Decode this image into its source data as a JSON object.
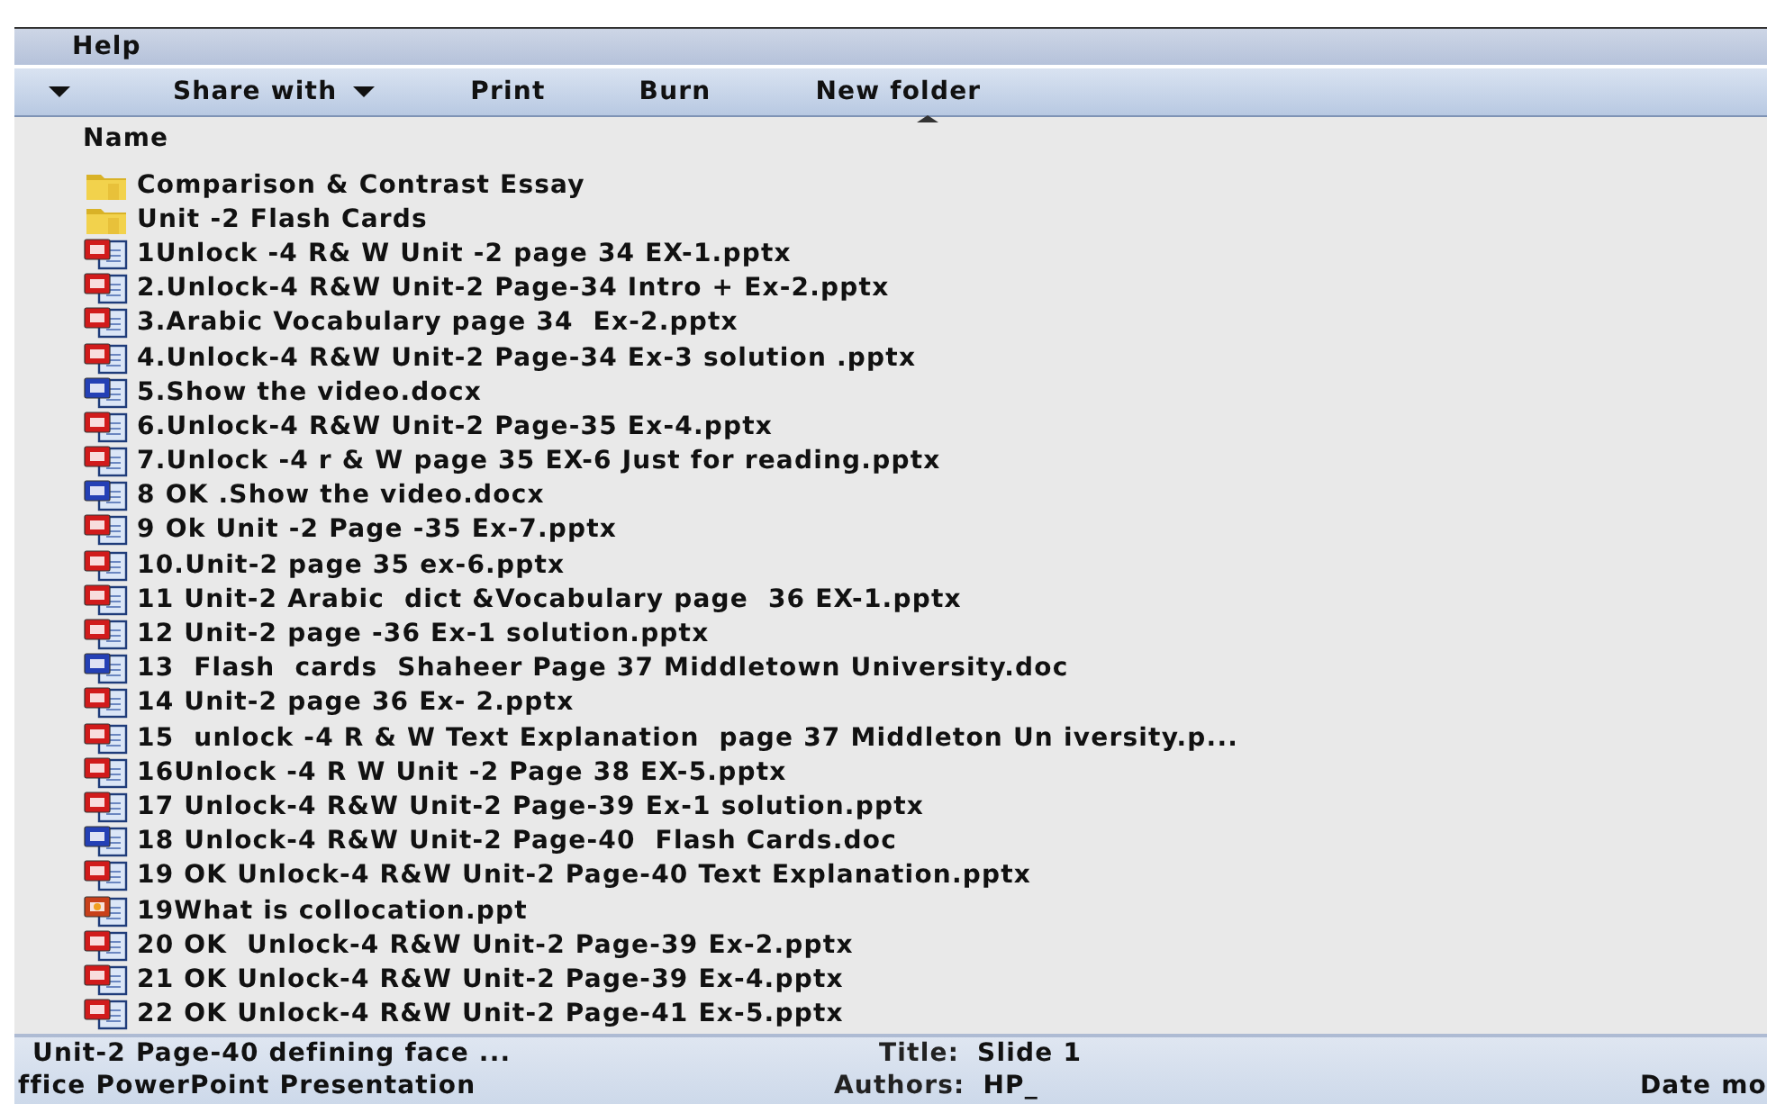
{
  "menu": [
    {
      "label": "Help"
    }
  ],
  "toolbar": [
    {
      "dropdown": true
    },
    {
      "label": "Share with",
      "dropdown": true
    },
    {
      "label": "Print",
      "dropdown": false
    },
    {
      "label": "Burn",
      "dropdown": false
    },
    {
      "label": "New folder",
      "dropdown": false
    }
  ],
  "columns": [
    {
      "label": "Name",
      "sorted": true
    }
  ],
  "files": [
    {
      "kind": "folder",
      "name": "Comparison & Contrast Essay"
    },
    {
      "kind": "folder",
      "name": "Unit -2 Flash Cards"
    },
    {
      "kind": "pptx",
      "name": "1Unlock -4 R& W Unit -2 page 34 EX-1.pptx"
    },
    {
      "kind": "pptx",
      "name": "2.Unlock-4 R&W Unit-2 Page-34 Intro + Ex-2.pptx"
    },
    {
      "kind": "pptx",
      "name": "3.Arabic Vocabulary page 34  Ex-2.pptx"
    },
    {
      "kind": "pptx",
      "name": "4.Unlock-4 R&W Unit-2 Page-34 Ex-3 solution .pptx"
    },
    {
      "kind": "docx",
      "name": "5.Show the video.docx"
    },
    {
      "kind": "pptx",
      "name": "6.Unlock-4 R&W Unit-2 Page-35 Ex-4.pptx"
    },
    {
      "kind": "pptx",
      "name": "7.Unlock -4 r & W page 35 EX-6 Just for reading.pptx"
    },
    {
      "kind": "docx",
      "name": "8 OK .Show the video.docx"
    },
    {
      "kind": "pptx",
      "name": "9 Ok Unit -2 Page -35 Ex-7.pptx"
    },
    {
      "kind": "pptx",
      "name": "10.Unit-2 page 35 ex-6.pptx"
    },
    {
      "kind": "pptx",
      "name": "11 Unit-2 Arabic  dict &Vocabulary page  36 EX-1.pptx"
    },
    {
      "kind": "pptx",
      "name": "12 Unit-2 page -36 Ex-1 solution.pptx"
    },
    {
      "kind": "docx",
      "name": "13  Flash  cards  Shaheer Page 37 Middletown University.doc"
    },
    {
      "kind": "pptx",
      "name": "14 Unit-2 page 36 Ex- 2.pptx"
    },
    {
      "kind": "pptx",
      "name": "15  unlock -4 R & W Text Explanation  page 37 Middleton Un iversity.p..."
    },
    {
      "kind": "pptx",
      "name": "16Unlock -4 R W Unit -2 Page 38 EX-5.pptx"
    },
    {
      "kind": "pptx",
      "name": "17 Unlock-4 R&W Unit-2 Page-39 Ex-1 solution.pptx"
    },
    {
      "kind": "docx",
      "name": "18 Unlock-4 R&W Unit-2 Page-40  Flash Cards.doc"
    },
    {
      "kind": "pptx",
      "name": "19 OK Unlock-4 R&W Unit-2 Page-40 Text Explanation.pptx"
    },
    {
      "kind": "ppt",
      "name": "19What is collocation.ppt"
    },
    {
      "kind": "pptx",
      "name": "20 OK  Unlock-4 R&W Unit-2 Page-39 Ex-2.pptx"
    },
    {
      "kind": "pptx",
      "name": "21 OK Unlock-4 R&W Unit-2 Page-39 Ex-4.pptx"
    },
    {
      "kind": "pptx",
      "name": "22 OK Unlock-4 R&W Unit-2 Page-41 Ex-5.pptx"
    }
  ],
  "details": {
    "file_name": "Unit-2 Page-40 defining face ...",
    "file_type": "ffice PowerPoint Presentation",
    "properties": [
      {
        "label": "Title:",
        "value": "Slide 1"
      },
      {
        "label": "Authors:",
        "value": "HP_"
      }
    ],
    "cut_label": "Date mo"
  }
}
